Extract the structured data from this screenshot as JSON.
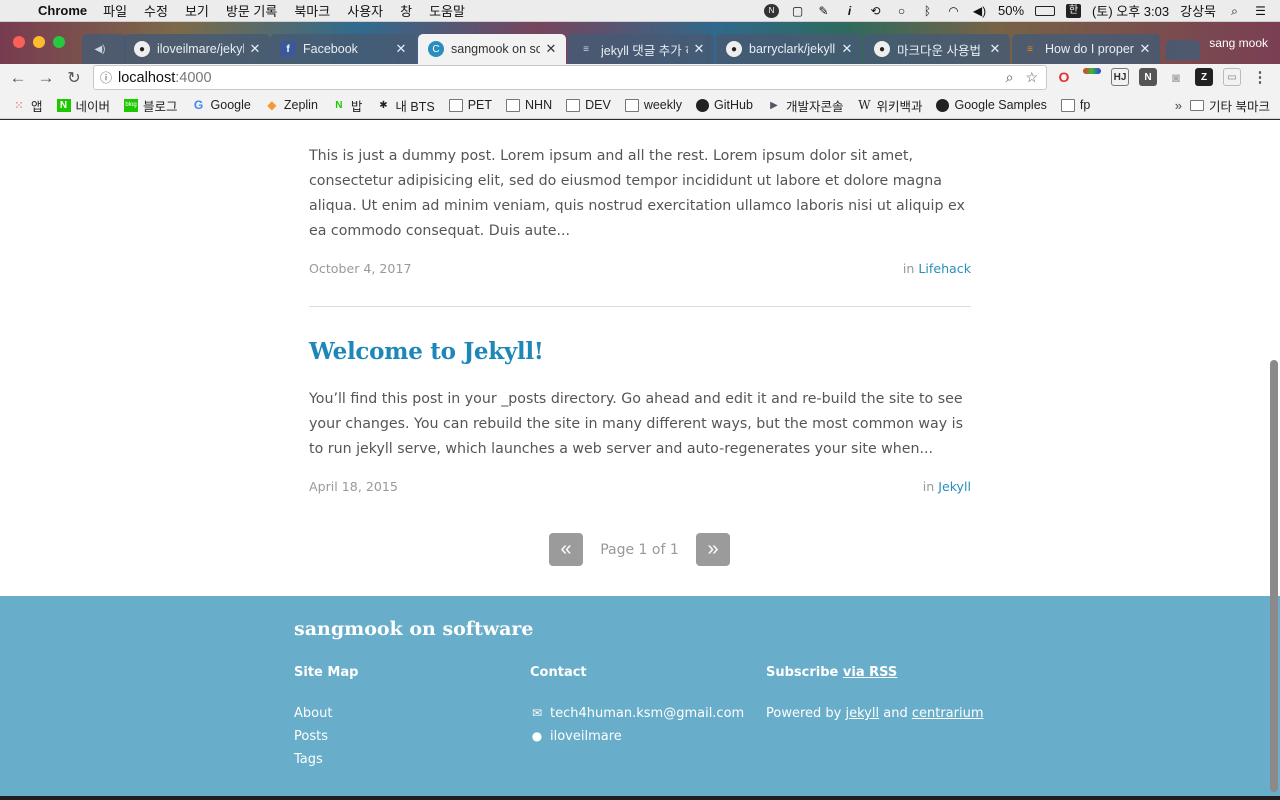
{
  "menubar": {
    "app_name": "Chrome",
    "menus": [
      "파일",
      "수정",
      "보기",
      "방문 기록",
      "북마크",
      "사용자",
      "창",
      "도움말"
    ],
    "battery": "50%",
    "clock": "(토) 오후 3:03",
    "user": "강상묵"
  },
  "tabs": [
    {
      "title": "",
      "icon": "speaker-icon"
    },
    {
      "title": "iloveilmare/jekyll",
      "icon": "github-icon"
    },
    {
      "title": "Facebook",
      "icon": "facebook-icon"
    },
    {
      "title": "sangmook on so",
      "icon": "chrome-page-icon"
    },
    {
      "title": "jekyll 댓글 추가 하",
      "icon": "doc-icon"
    },
    {
      "title": "barryclark/jekyll",
      "icon": "github-icon"
    },
    {
      "title": "마크다운 사용법",
      "icon": "github-icon"
    },
    {
      "title": "How do I proper",
      "icon": "stackoverflow-icon"
    }
  ],
  "profile_name": "sang mook",
  "address": {
    "host": "localhost",
    "port": ":4000"
  },
  "bookmarks": [
    {
      "label": "앱",
      "icon": "apps-grid-icon"
    },
    {
      "label": "네이버",
      "icon": "naver-icon"
    },
    {
      "label": "블로그",
      "icon": "blog-icon"
    },
    {
      "label": "Google",
      "icon": "google-icon"
    },
    {
      "label": "Zeplin",
      "icon": "zeplin-icon"
    },
    {
      "label": "밥",
      "icon": "naver-green-icon"
    },
    {
      "label": "내 BTS",
      "icon": "bts-icon"
    },
    {
      "label": "PET",
      "icon": "folder-icon"
    },
    {
      "label": "NHN",
      "icon": "folder-icon"
    },
    {
      "label": "DEV",
      "icon": "folder-icon"
    },
    {
      "label": "weekly",
      "icon": "folder-icon"
    },
    {
      "label": "GitHub",
      "icon": "github-icon"
    },
    {
      "label": "개발자콘솔",
      "icon": "console-icon"
    },
    {
      "label": "위키백과",
      "icon": "wikipedia-icon"
    },
    {
      "label": "Google Samples",
      "icon": "github-icon"
    },
    {
      "label": "fp",
      "icon": "folder-icon"
    }
  ],
  "bookmarks_overflow": "»",
  "other_bookmarks": "기타 북마크",
  "posts": [
    {
      "excerpt": "This is just a dummy post. Lorem ipsum and all the rest. Lorem ipsum dolor sit amet, consectetur adipisicing elit, sed do eiusmod tempor incididunt ut labore et dolore magna aliqua. Ut enim ad minim veniam, quis nostrud exercitation ullamco laboris nisi ut aliquip ex ea commodo consequat. Duis aute...",
      "date": "October 4, 2017",
      "in_label": "in",
      "category": "Lifehack"
    },
    {
      "title": "Welcome to Jekyll!",
      "excerpt": "You’ll find this post in your _posts directory. Go ahead and edit it and re-build the site to see your changes. You can rebuild the site in many different ways, but the most common way is to run jekyll serve, which launches a web server and auto-regenerates your site when...",
      "date": "April 18, 2015",
      "in_label": "in",
      "category": "Jekyll"
    }
  ],
  "pagination": {
    "prev": "«",
    "label": "Page 1 of 1",
    "next": "»"
  },
  "footer": {
    "brand": "sangmook on software",
    "sitemap_title": "Site Map",
    "sitemap_links": [
      "About",
      "Posts",
      "Tags"
    ],
    "contact_title": "Contact",
    "email": "tech4human.ksm@gmail.com",
    "github": "iloveilmare",
    "subscribe_prefix": "Subscribe",
    "subscribe_link": "via RSS",
    "powered_prefix": "Powered by",
    "powered_link1": "jekyll",
    "powered_and": "and",
    "powered_link2": "centrarium"
  }
}
